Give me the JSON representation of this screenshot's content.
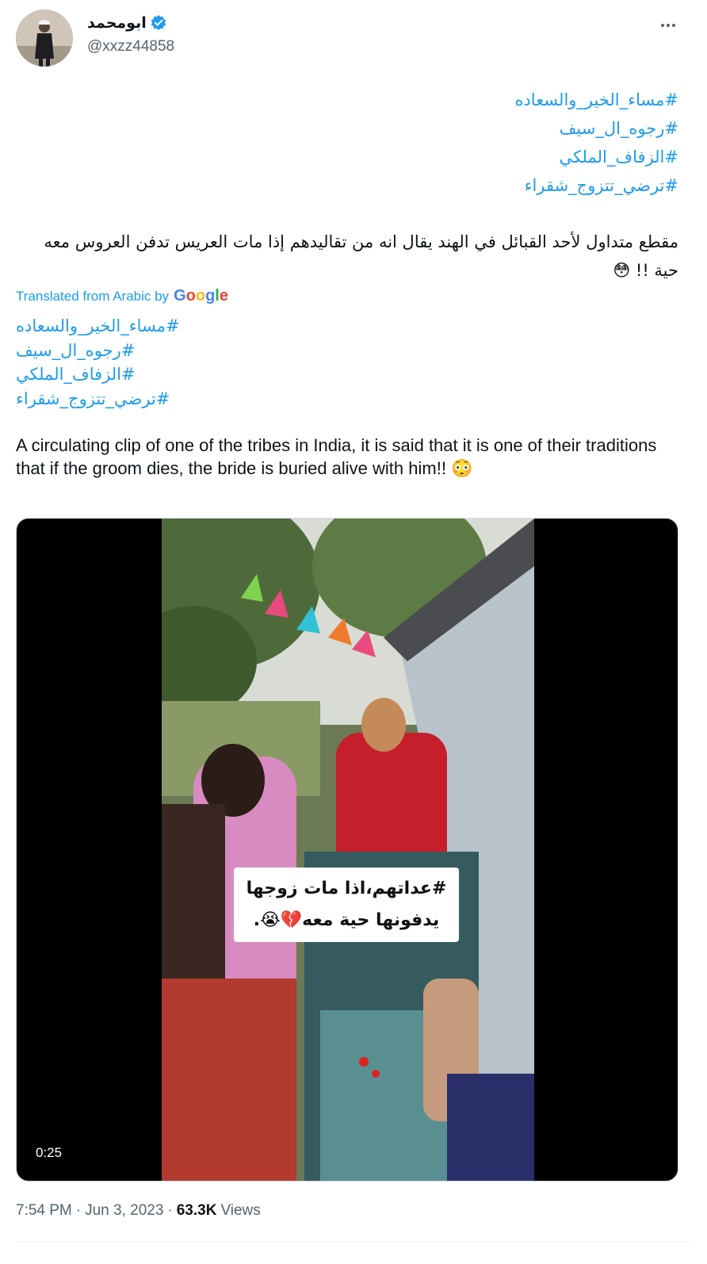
{
  "author": {
    "display_name": "ابومحمد",
    "handle": "@xxzz44858",
    "verified_icon": "verified-badge-icon"
  },
  "original": {
    "hashtags": [
      "#مساء_الخير_والسعاده",
      "#رجوه_ال_سيف",
      "#الزفاف_الملكي",
      "#ترضي_تتزوج_شقراء"
    ],
    "text": "مقطع متداول لأحد القبائل في الهند يقال انه من تقاليدهم إذا مات العريس تدفن العروس معه حية !! 😳"
  },
  "translation": {
    "label": "Translated from Arabic by",
    "provider": "Google",
    "hashtags": [
      "#مساء_الخير_والسعاده",
      "#رجوه_ال_سيف",
      "#الزفاف_الملكي",
      "#ترضي_تتزوج_شقراء"
    ],
    "text": "A circulating clip of one of the tribes in India, it is said that it is one of their traditions that if the groom dies, the bride is buried alive with him!! 😳"
  },
  "media": {
    "type": "video",
    "duration": "0:25",
    "caption_line1": "#عداتهم،اذا مات زوجها",
    "caption_line2": "يدفونها حية معه💔😭."
  },
  "meta": {
    "time": "7:54 PM",
    "separator": "·",
    "date": "Jun 3, 2023",
    "views_count": "63.3K",
    "views_label": "Views"
  },
  "colors": {
    "link": "#1d9bf0",
    "text": "#0f1419",
    "secondary": "#536471"
  }
}
